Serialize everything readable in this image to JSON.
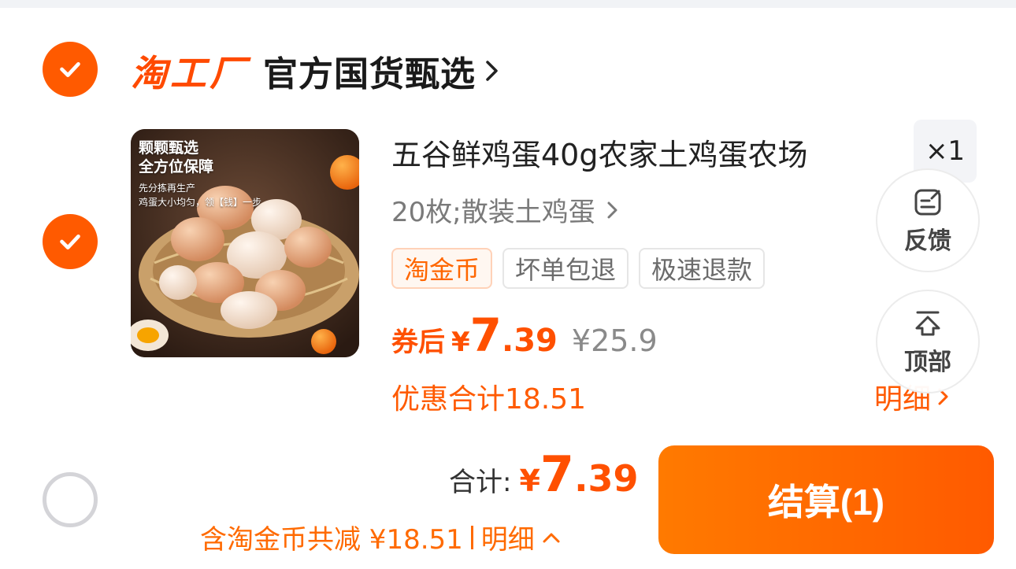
{
  "store": {
    "brand": "淘工厂",
    "name": "官方国货甄选",
    "selected": true
  },
  "item": {
    "selected": true,
    "thumb_line1": "颗颗甄选",
    "thumb_line2": "全方位保障",
    "thumb_line3": "先分拣再生产",
    "thumb_line4": "鸡蛋大小均匀，领【钱】一步",
    "title": "五谷鲜鸡蛋40g农家土鸡蛋农场",
    "quantity": "×1",
    "spec": "20枚;散装土鸡蛋",
    "tags": [
      "淘金币",
      "坏单包退",
      "极速退款"
    ],
    "price_label": "券后",
    "currency": "¥",
    "price_int": "7",
    "price_dec": ".39",
    "original_price": "¥25.9",
    "discount_total": "优惠合计18.51",
    "detail_label": "明细"
  },
  "floating": {
    "feedback": "反馈",
    "top": "顶部"
  },
  "footer": {
    "select_all": false,
    "total_label": "合计:",
    "currency": "¥",
    "total_int": "7",
    "total_dec": ".39",
    "reduce_text": "含淘金币共减 ¥18.51",
    "reduce_detail": "明细",
    "checkout_label": "结算(1)"
  },
  "colors": {
    "accent": "#ff5a00",
    "checkout_start": "#ff7a00",
    "checkout_end": "#ff5a00"
  },
  "icons": [
    "check-icon",
    "chevron-right-icon",
    "feedback-icon",
    "back-to-top-icon",
    "chevron-up-icon"
  ]
}
